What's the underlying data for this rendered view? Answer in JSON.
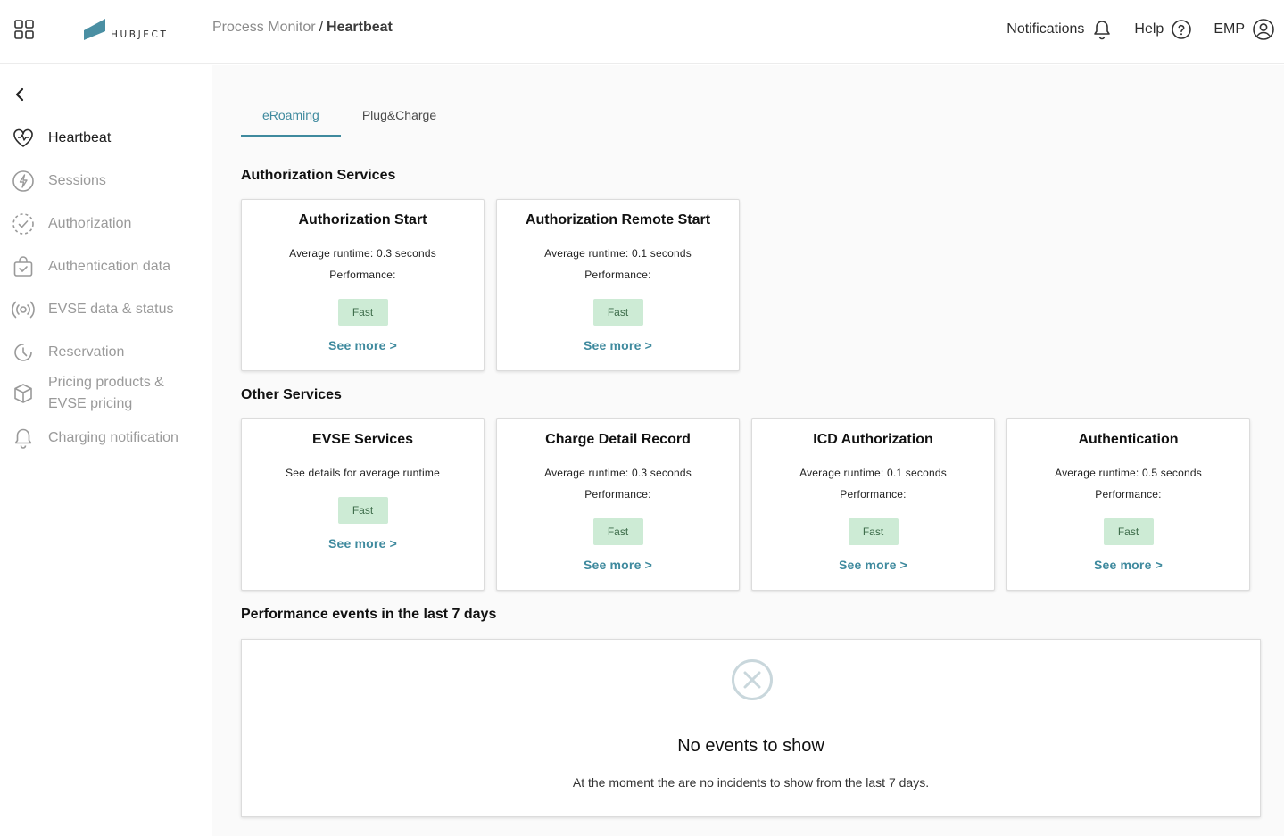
{
  "header": {
    "logo_text": "HUBJECT",
    "breadcrumb": {
      "parent": "Process Monitor",
      "separator": "/",
      "current": "Heartbeat"
    },
    "notifications_label": "Notifications",
    "help_label": "Help",
    "user_label": "EMP"
  },
  "sidebar": {
    "items": [
      {
        "label": "Heartbeat",
        "icon": "heart-pulse-icon",
        "active": true
      },
      {
        "label": "Sessions",
        "icon": "lightning-circle-icon"
      },
      {
        "label": "Authorization",
        "icon": "check-circle-dashed-icon"
      },
      {
        "label": "Authentication data",
        "icon": "bag-check-icon"
      },
      {
        "label": "EVSE data & status",
        "icon": "broadcast-icon"
      },
      {
        "label": "Reservation",
        "icon": "clock-icon"
      },
      {
        "label": "Pricing products &",
        "label2": "EVSE pricing",
        "icon": "box-icon"
      },
      {
        "label": "Charging notification",
        "icon": "bell-icon"
      }
    ]
  },
  "tabs": [
    {
      "label": "eRoaming",
      "active": true
    },
    {
      "label": "Plug&Charge"
    }
  ],
  "sections": {
    "authorization": "Authorization Services",
    "other": "Other Services",
    "events": "Performance events in the last 7 days"
  },
  "cards": {
    "auth_start": {
      "title": "Authorization Start",
      "runtime": "Average runtime: 0.3 seconds",
      "perf": "Performance:",
      "badge": "Fast",
      "link": "See more >"
    },
    "auth_remote": {
      "title": "Authorization Remote Start",
      "runtime": "Average runtime: 0.1 seconds",
      "perf": "Performance:",
      "badge": "Fast",
      "link": "See more >"
    },
    "evse": {
      "title": "EVSE Services",
      "runtime": "See details for average runtime",
      "badge": "Fast",
      "link": "See more >"
    },
    "cdr": {
      "title": "Charge Detail Record",
      "runtime": "Average runtime: 0.3 seconds",
      "perf": "Performance:",
      "badge": "Fast",
      "link": "See more >"
    },
    "icd": {
      "title": "ICD Authorization",
      "runtime": "Average runtime: 0.1 seconds",
      "perf": "Performance:",
      "badge": "Fast",
      "link": "See more >"
    },
    "authentication": {
      "title": "Authentication",
      "runtime": "Average runtime: 0.5 seconds",
      "perf": "Performance:",
      "badge": "Fast",
      "link": "See more >"
    }
  },
  "events": {
    "title": "No events to show",
    "subtitle": "At the moment the are no incidents to show from the last 7 days."
  },
  "colors": {
    "accent": "#3f8a9e",
    "badge_bg": "#cdebd5",
    "badge_text": "#3c6b49",
    "logo": "#4a8fa3"
  }
}
